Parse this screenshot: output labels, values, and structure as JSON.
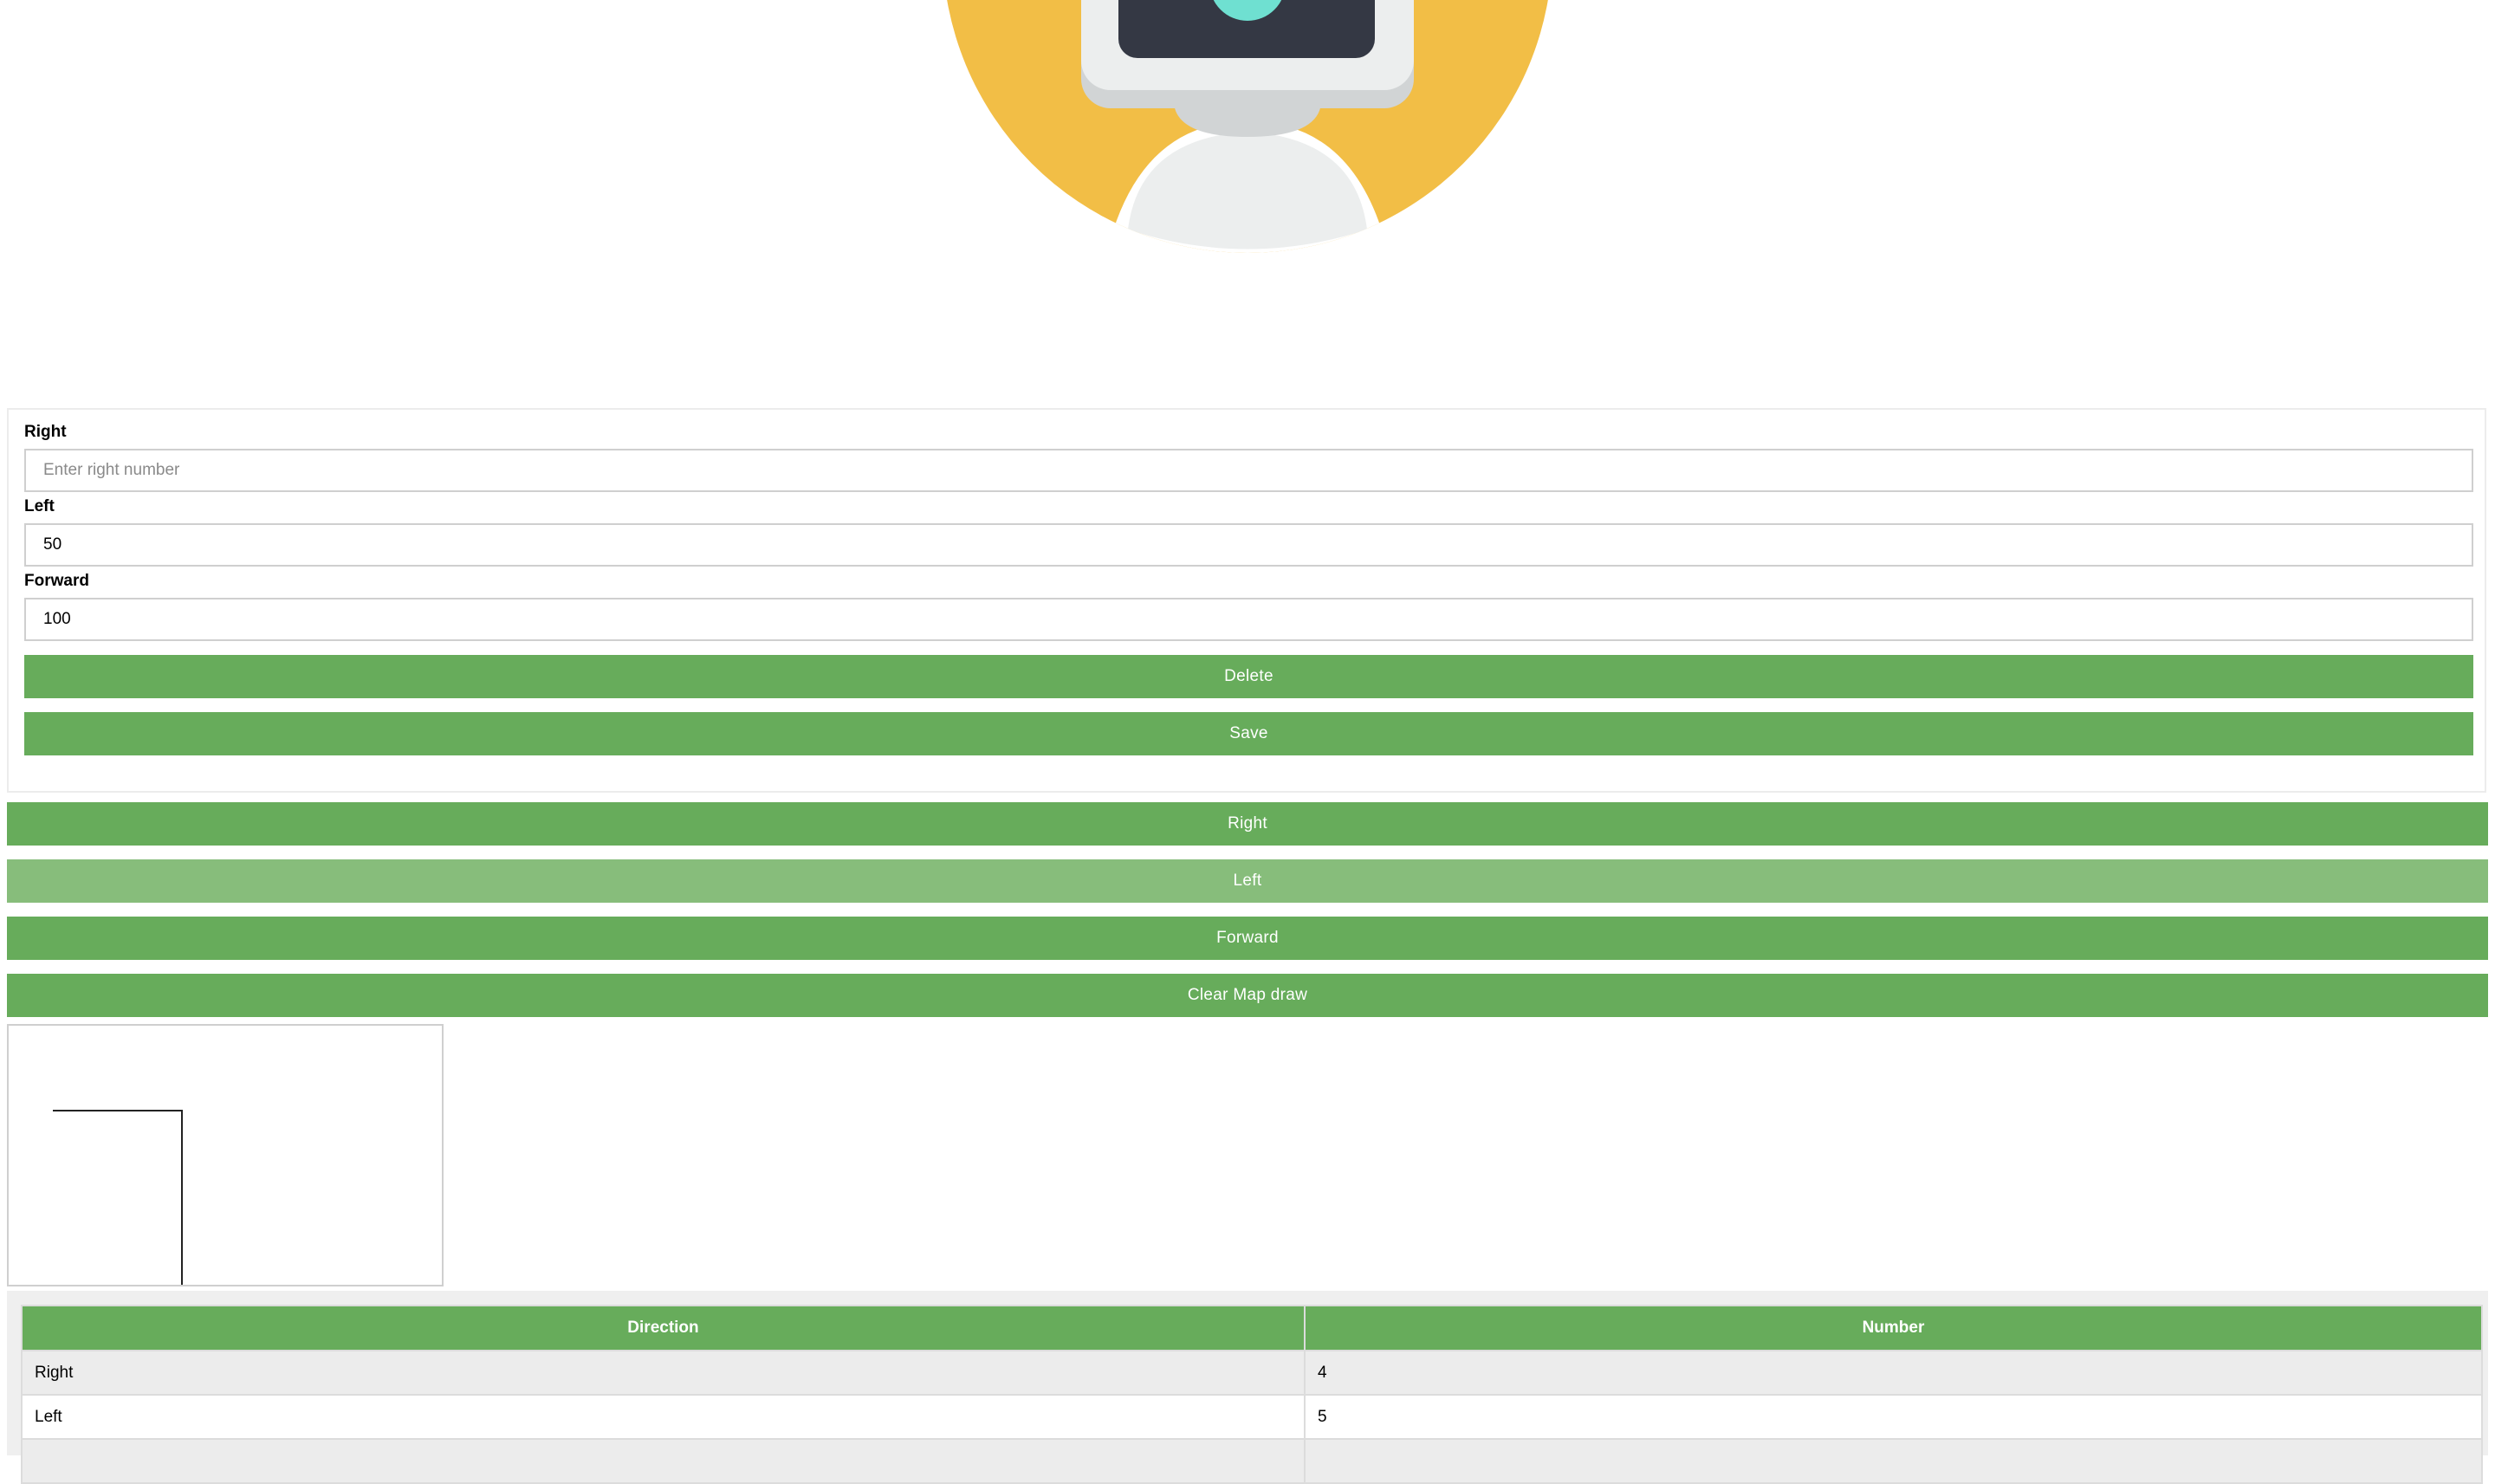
{
  "colors": {
    "accent_green": "#67ac5b",
    "accent_green_faded": "#87bd7b",
    "hero_yellow": "#f2be46",
    "robot_screen": "#343844",
    "robot_eye": "#6fe0d1"
  },
  "hero": {
    "icon": "robot-avatar-icon"
  },
  "form": {
    "right_label": "Right",
    "right_value": "",
    "right_placeholder": "Enter right number",
    "left_label": "Left",
    "left_value": "50",
    "forward_label": "Forward",
    "forward_value": "100",
    "delete_label": "Delete",
    "save_label": "Save"
  },
  "controls": {
    "right_label": "Right",
    "left_label": "Left",
    "forward_label": "Forward",
    "clear_label": "Clear Map draw"
  },
  "table": {
    "headers": [
      "Direction",
      "Number"
    ],
    "rows": [
      {
        "direction": "Right",
        "number": "4"
      },
      {
        "direction": "Left",
        "number": "5"
      }
    ]
  }
}
